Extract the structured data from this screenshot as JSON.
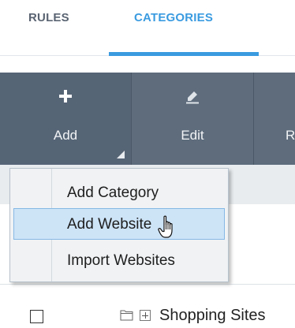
{
  "tabs": {
    "rules": "RULES",
    "categories": "CATEGORIES",
    "active": "CATEGORIES"
  },
  "toolbar": {
    "add_label": "Add",
    "add_icon": "plus-icon",
    "edit_label": "Edit",
    "edit_icon": "pencil-icon",
    "next_label_partial": "R"
  },
  "dropdown": {
    "items": [
      {
        "label": "Add Category"
      },
      {
        "label": "Add Website"
      },
      {
        "label": "Import Websites"
      }
    ],
    "hovered": "Add Website"
  },
  "list": {
    "rows": [
      {
        "label": "Shopping Sites",
        "checked": false
      }
    ]
  },
  "colors": {
    "accent": "#3a9be0",
    "toolbar_bg": "#5e6c7c",
    "menu_hover": "#cde4f7"
  }
}
